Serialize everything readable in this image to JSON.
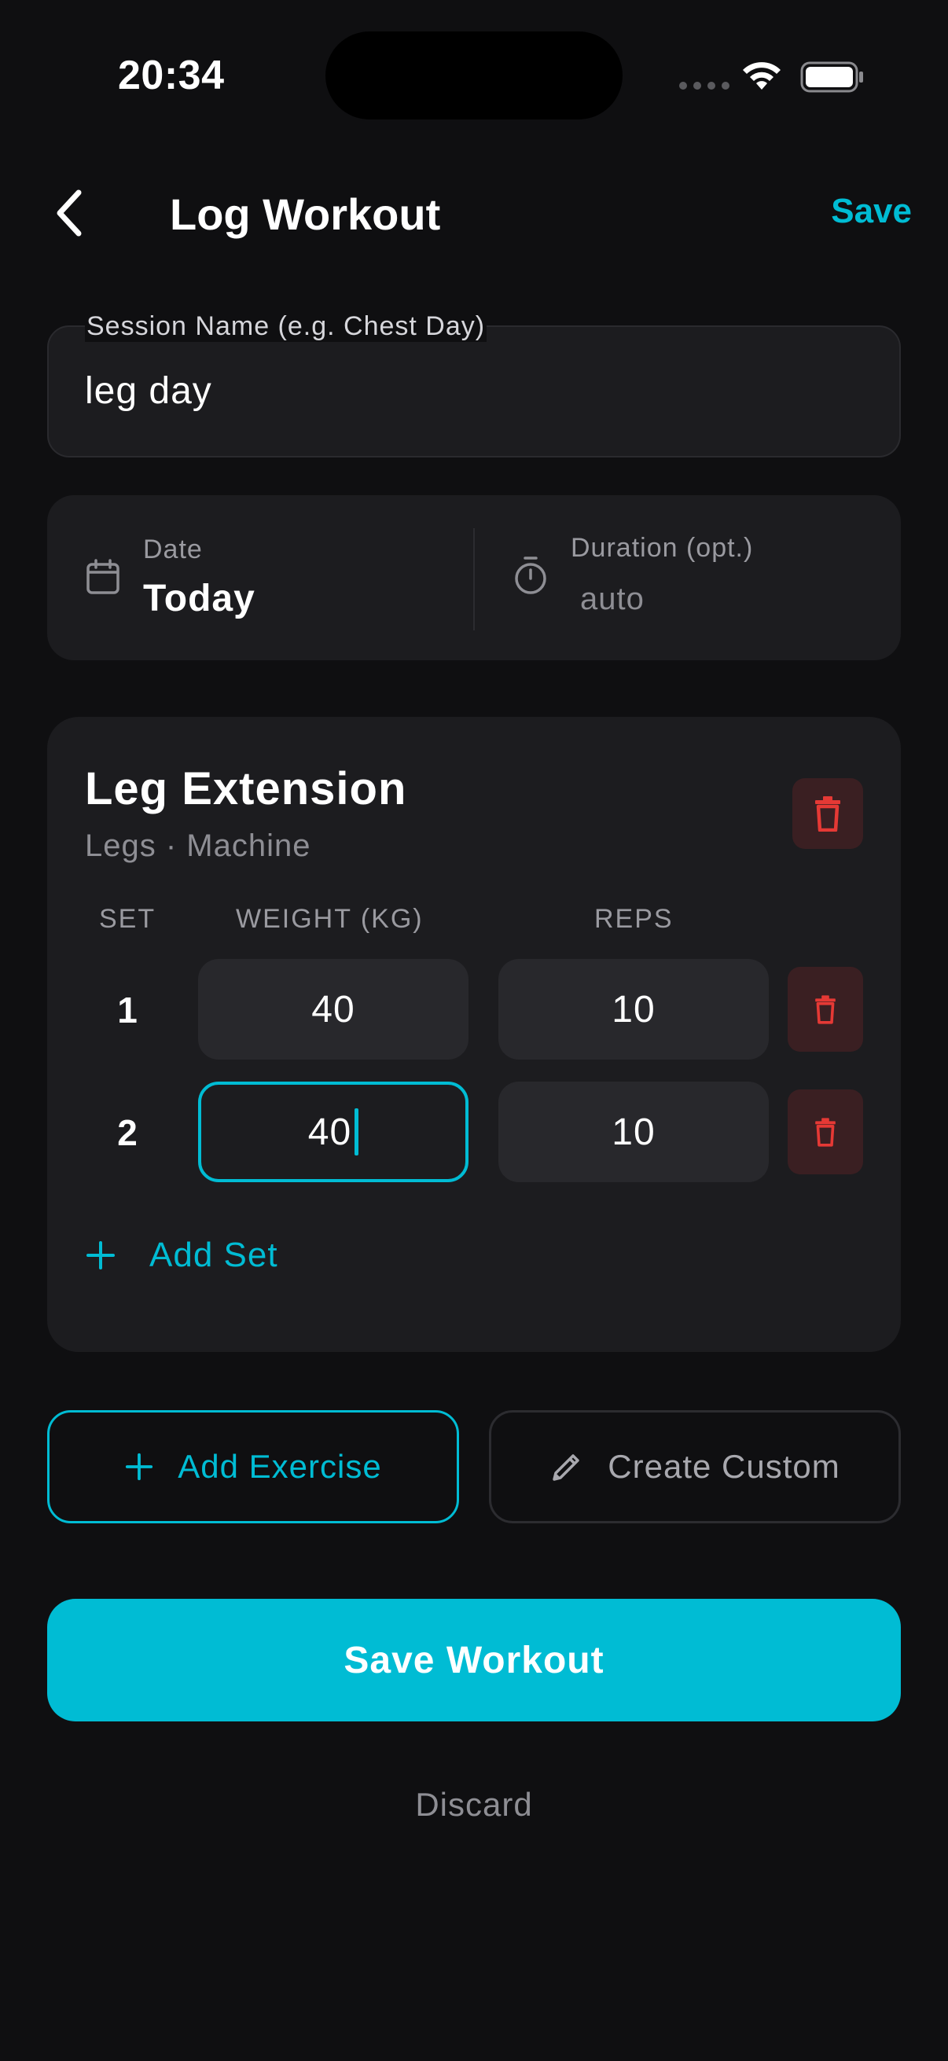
{
  "status_bar": {
    "time": "20:34"
  },
  "header": {
    "title": "Log Workout",
    "save_label": "Save"
  },
  "session": {
    "label": "Session Name (e.g. Chest Day)",
    "value": "leg day"
  },
  "meta": {
    "date_label": "Date",
    "date_value": "Today",
    "duration_label": "Duration (opt.)",
    "duration_placeholder": "auto"
  },
  "exercise": {
    "name": "Leg Extension",
    "subtitle": "Legs · Machine",
    "columns": {
      "set": "SET",
      "weight": "WEIGHT (KG)",
      "reps": "REPS"
    },
    "sets": [
      {
        "set": "1",
        "weight": "40",
        "reps": "10"
      },
      {
        "set": "2",
        "weight": "40",
        "reps": "10"
      }
    ],
    "add_set_label": "Add Set"
  },
  "actions": {
    "add_exercise": "Add Exercise",
    "create_custom": "Create Custom",
    "save_workout": "Save Workout",
    "discard": "Discard"
  },
  "colors": {
    "accent": "#00bcd4",
    "danger": "#e53935",
    "background": "#0f0f11",
    "card": "#1c1c1f"
  },
  "icons": {
    "back": "chevron-left-icon",
    "calendar": "calendar-icon",
    "timer": "stopwatch-icon",
    "delete": "trash-icon",
    "add": "plus-icon",
    "edit": "pencil-icon"
  }
}
